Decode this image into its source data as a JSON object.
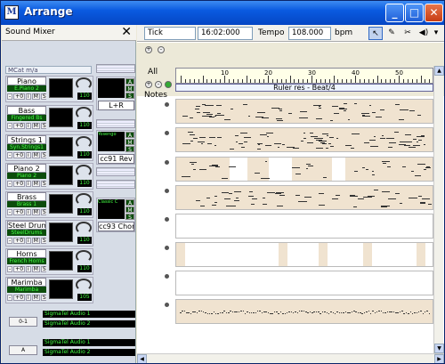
{
  "window": {
    "title": "Arrange",
    "app_icon": "M",
    "controls": [
      "minimize-icon",
      "maximize-icon",
      "close-icon"
    ]
  },
  "mixer": {
    "title": "Sound Mixer",
    "close_glyph": "✕",
    "category": "MCat m/a",
    "control_labels": {
      "minus": "-",
      "plus": "+0",
      "i": "i",
      "m": "M",
      "s": "S"
    },
    "channels": [
      {
        "name": "Piano",
        "instrument": "E.Piano 2",
        "value": "110"
      },
      {
        "name": "Bass",
        "instrument": "Fingered Bs",
        "value": "110"
      },
      {
        "name": "Strings 1",
        "instrument": "Syn.Strings1",
        "value": "110"
      },
      {
        "name": "Piano 2",
        "instrument": "Piano 2",
        "value": "110"
      },
      {
        "name": "Brass",
        "instrument": "Brass 1",
        "value": "110"
      },
      {
        "name": "Steel Drum",
        "instrument": "SteelDrums",
        "value": "110"
      },
      {
        "name": "Horns",
        "instrument": "French Horns",
        "value": "110"
      },
      {
        "name": "Marimba",
        "instrument": "Marimba",
        "value": "105"
      }
    ],
    "master_label": "L+R",
    "effects": [
      {
        "preset": "Yosengo",
        "label": "cc91 Rev"
      },
      {
        "preset": "Classic C",
        "label": "cc93 Chor"
      }
    ],
    "fx_buttons": [
      "A",
      "M",
      "S"
    ],
    "outputs": [
      {
        "button": "0-1",
        "devices": [
          "SigmaTel Audio 1",
          "SigmaTel Audio 2"
        ]
      },
      {
        "button": "A",
        "devices": [
          "SigmaTel Audio 1",
          "SigmaTel Audio 2"
        ]
      }
    ]
  },
  "toolbar": {
    "snap_value": "Tick",
    "time_value": "16:02:000",
    "tempo_label": "Tempo",
    "tempo_value": "108.000",
    "tempo_unit": "bpm",
    "tools": [
      "pointer-icon",
      "pencil-icon",
      "scissors-icon",
      "speaker-icon"
    ]
  },
  "arrange": {
    "all_label": "All",
    "notes_label": "Notes",
    "ruler_label": "Ruler res - Beat/4",
    "ruler_numbers": [
      "10",
      "20",
      "30",
      "40",
      "50"
    ]
  }
}
